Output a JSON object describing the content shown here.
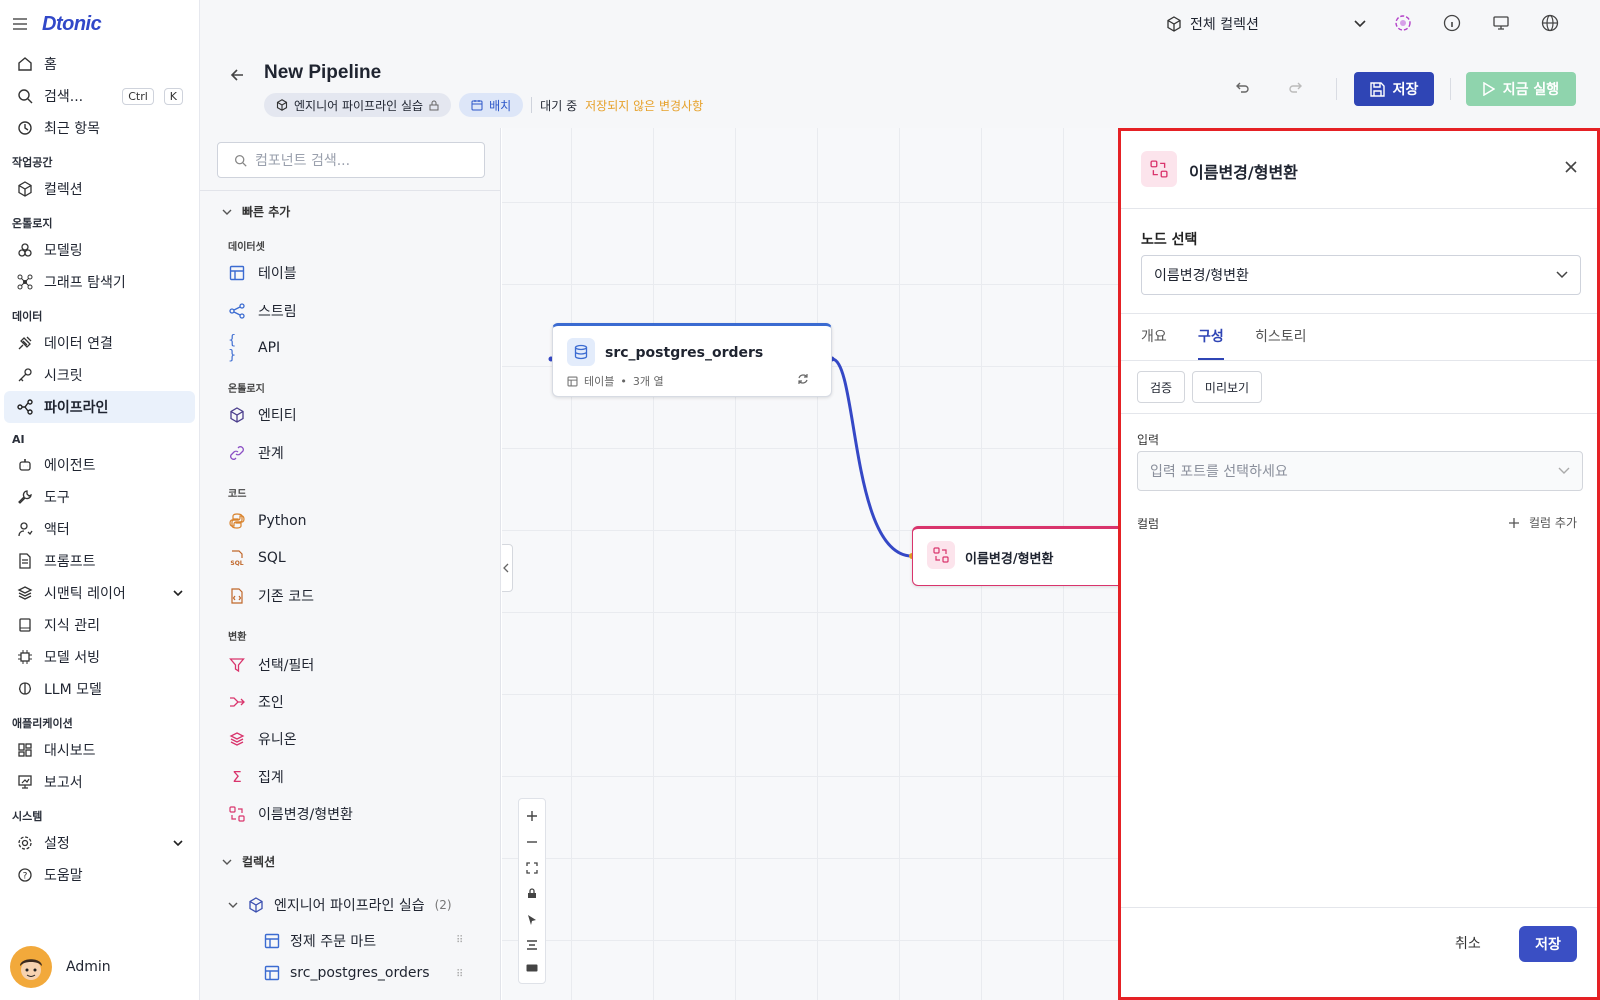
{
  "app": {
    "logo": "Dtonic"
  },
  "nav": {
    "home": "홈",
    "search": "검색...",
    "kbd_ctrl": "Ctrl",
    "kbd_k": "K",
    "recent": "최근 항목",
    "sec_workspace": "작업공간",
    "collection": "컬렉션",
    "sec_ontology": "온톨로지",
    "modeling": "모델링",
    "graph": "그래프 탐색기",
    "sec_data": "데이터",
    "data_conn": "데이터 연결",
    "secret": "시크릿",
    "pipeline": "파이프라인",
    "sec_ai": "AI",
    "agent": "에이전트",
    "tool": "도구",
    "actor": "액터",
    "prompt": "프롬프트",
    "semantic": "시맨틱 레이어",
    "knowledge": "지식 관리",
    "serving": "모델 서빙",
    "llm": "LLM 모델",
    "sec_app": "애플리케이션",
    "dashboard": "대시보드",
    "report": "보고서",
    "sec_system": "시스템",
    "settings": "설정",
    "help": "도움말",
    "user": "Admin"
  },
  "header": {
    "collection_select": "전체 컬렉션",
    "title": "New Pipeline",
    "chip_project": "엔지니어 파이프라인 실습",
    "chip_batch": "배치",
    "status": "대기 중",
    "unsaved": "저장되지 않은 변경사항",
    "save": "저장",
    "run": "지금 실행"
  },
  "components": {
    "search_placeholder": "컴포넌트 검색...",
    "quick_add": "빠른 추가",
    "dataset": "데이터셋",
    "table": "테이블",
    "stream": "스트림",
    "api": "API",
    "ontology": "온톨로지",
    "entity": "엔티티",
    "relation": "관계",
    "code": "코드",
    "python": "Python",
    "sql": "SQL",
    "legacy": "기존 코드",
    "transform": "변환",
    "filter": "선택/필터",
    "join": "조인",
    "union": "유니온",
    "aggregate": "집계",
    "rename": "이름변경/형변환",
    "collections": "컬렉션",
    "tree_project": "엔지니어 파이프라인 실습",
    "tree_count": "(2)",
    "tree_item1": "정제 주문 마트",
    "tree_item2": "src_postgres_orders"
  },
  "canvas": {
    "node1_title": "src_postgres_orders",
    "node1_type": "테이블",
    "node1_cols": "3개 열",
    "node2_title": "이름변경/형변환"
  },
  "panel": {
    "title": "이름변경/형변환",
    "node_select_label": "노드 선택",
    "node_select_value": "이름변경/형변환",
    "tab_overview": "개요",
    "tab_config": "구성",
    "tab_history": "히스토리",
    "validate": "검증",
    "preview": "미리보기",
    "input_label": "입력",
    "input_placeholder": "입력 포트를 선택하세요",
    "column_label": "컬럼",
    "add_column": "컬럼 추가",
    "cancel": "취소",
    "save": "저장"
  },
  "colors": {
    "primary": "#2f45b5",
    "run": "#8fd4ad",
    "warn": "#e6a12a",
    "highlight": "#e52125",
    "transform": "#d9346c"
  }
}
